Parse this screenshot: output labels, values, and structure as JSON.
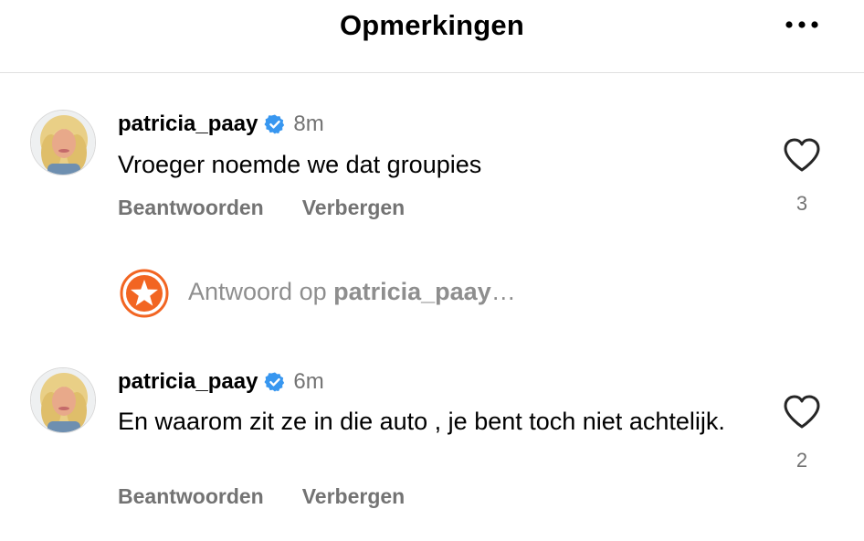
{
  "header": {
    "title": "Opmerkingen",
    "more_icon": "more-horizontal-icon"
  },
  "comments": [
    {
      "username": "patricia_paay",
      "verified": true,
      "time": "8m",
      "text": "Vroeger noemde we dat groupies",
      "actions": {
        "reply": "Beantwoorden",
        "hide": "Verbergen"
      },
      "likes": "3"
    },
    {
      "username": "patricia_paay",
      "verified": true,
      "time": "6m",
      "text": "En waarom zit ze in die auto , je bent toch niet achtelijk.",
      "actions": {
        "reply": "Beantwoorden",
        "hide": "Verbergen"
      },
      "likes": "2"
    }
  ],
  "reply_box": {
    "prefix": "Antwoord op ",
    "target": "patricia_paay",
    "suffix": "…",
    "avatar_icon": "star-badge-icon"
  },
  "colors": {
    "verified_blue": "#3897f0",
    "muted_text": "#737373",
    "accent_orange": "#f26522"
  }
}
